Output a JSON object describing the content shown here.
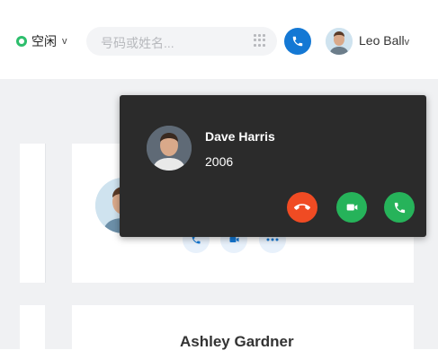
{
  "header": {
    "status_label": "空闲",
    "status_chevron": "v",
    "search_placeholder": "号码或姓名...",
    "user_name": "Leo Ball",
    "user_chevron": "v"
  },
  "popup": {
    "caller_name": "Dave Harris",
    "caller_number": "2006"
  },
  "contact_card_bottom": {
    "name": "Ashley Gardner"
  },
  "colors": {
    "status_green": "#2dbe6c",
    "call_blue": "#1478d4",
    "decline_red": "#f04b23",
    "accept_green": "#26b35a",
    "popup_bg": "#2b2b2b"
  },
  "icons": {
    "dialpad": "dialpad-icon",
    "call": "phone-icon",
    "decline": "phone-hangup-icon",
    "video": "video-camera-icon",
    "answer": "phone-answer-icon",
    "more": "more-dots-icon"
  }
}
